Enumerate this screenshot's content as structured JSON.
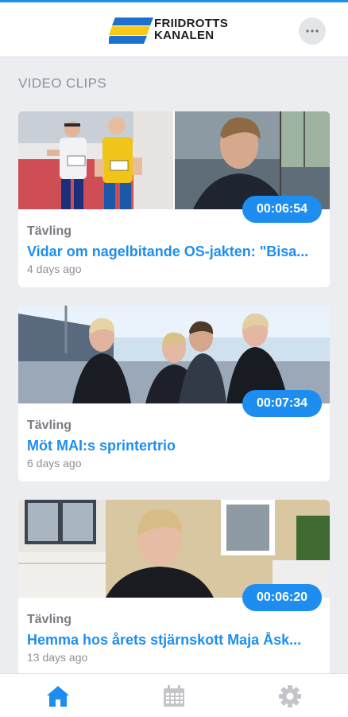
{
  "app": {
    "logo_line1": "FRIIDROTTS",
    "logo_line2": "KANALEN",
    "more_icon": "more-horizontal-icon"
  },
  "section": {
    "title": "VIDEO CLIPS"
  },
  "clips": [
    {
      "category": "Tävling",
      "title": "Vidar om nagelbitande OS-jakten: \"Bisa...",
      "age": "4 days ago",
      "duration": "00:06:54"
    },
    {
      "category": "Tävling",
      "title": "Möt MAI:s sprintertrio",
      "age": "6 days ago",
      "duration": "00:07:34"
    },
    {
      "category": "Tävling",
      "title": "Hemma hos årets stjärnskott Maja Åsk...",
      "age": "13 days ago",
      "duration": "00:06:20"
    }
  ],
  "nav": [
    {
      "name": "home",
      "icon": "home-icon",
      "active": true
    },
    {
      "name": "calendar",
      "icon": "calendar-icon",
      "active": false
    },
    {
      "name": "settings",
      "icon": "gear-icon",
      "active": false
    }
  ],
  "colors": {
    "accent": "#1d8ef0",
    "background": "#ecedf1",
    "inactive": "#c4c5c9",
    "logo_yellow": "#f6c91b",
    "logo_blue": "#1d6fd0"
  }
}
